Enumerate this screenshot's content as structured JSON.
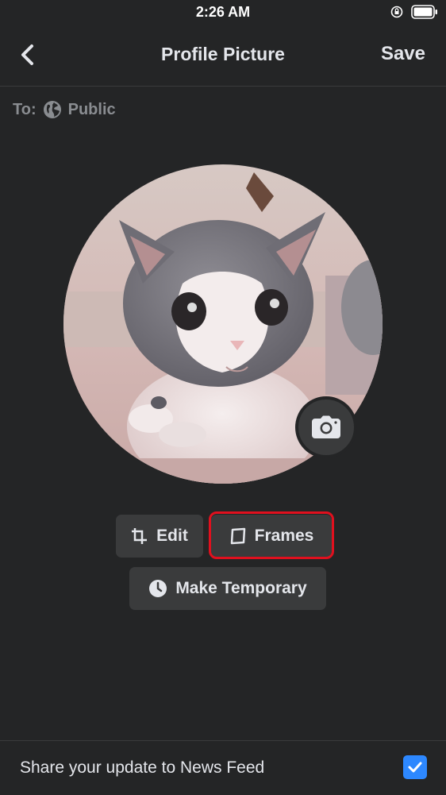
{
  "status_bar": {
    "time": "2:26 AM",
    "icons": [
      "orientation-lock-icon",
      "battery-icon"
    ]
  },
  "nav": {
    "back_icon": "chevron-left-icon",
    "title": "Profile Picture",
    "save_label": "Save"
  },
  "audience": {
    "to_label": "To:",
    "icon": "globe-icon",
    "value": "Public"
  },
  "profile_picture": {
    "subject": "kitten",
    "camera_icon": "camera-icon"
  },
  "actions": {
    "edit": {
      "label": "Edit",
      "icon": "crop-icon"
    },
    "frames": {
      "label": "Frames",
      "icon": "frame-icon",
      "highlight_color": "#e0101e"
    },
    "make_temporary": {
      "label": "Make Temporary",
      "icon": "clock-icon"
    }
  },
  "share": {
    "label": "Share your update to News Feed",
    "checked": true,
    "checkbox_color": "#2d88ff"
  },
  "colors": {
    "background": "#242526",
    "button_background": "#3a3b3c",
    "text_primary": "#e4e6eb",
    "text_secondary": "#8a8d91"
  }
}
